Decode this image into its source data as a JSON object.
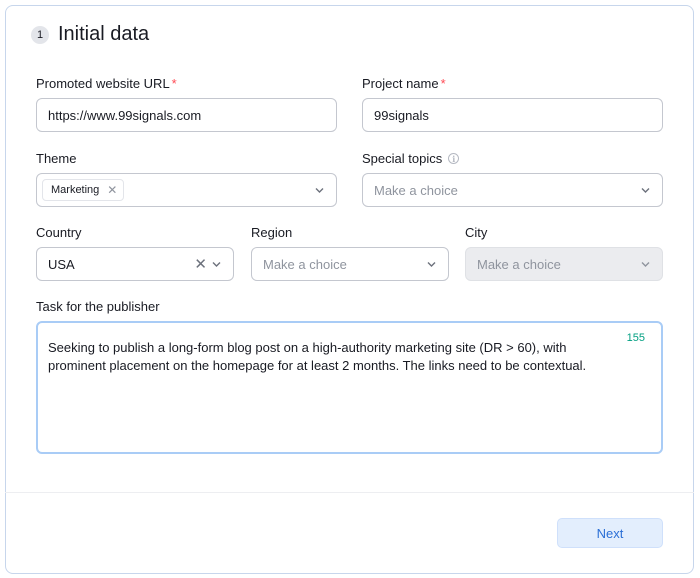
{
  "section": {
    "step": "1",
    "title": "Initial data"
  },
  "fields": {
    "url": {
      "label": "Promoted website URL",
      "required": "*",
      "value": "https://www.99signals.com"
    },
    "project": {
      "label": "Project name",
      "required": "*",
      "value": "99signals"
    },
    "theme": {
      "label": "Theme",
      "tag": "Marketing"
    },
    "topics": {
      "label": "Special topics",
      "placeholder": "Make a choice"
    },
    "country": {
      "label": "Country",
      "value": "USA"
    },
    "region": {
      "label": "Region",
      "placeholder": "Make a choice"
    },
    "city": {
      "label": "City",
      "placeholder": "Make a choice"
    },
    "task": {
      "label": "Task for the publisher",
      "counter": "155",
      "value": "Seeking to publish a long-form blog post on a high-authority marketing site (DR > 60), with prominent placement on the homepage for at least 2 months. The links need to be contextual."
    }
  },
  "actions": {
    "next_label": "Next"
  },
  "icons": {
    "chevron": "chevron-down-icon",
    "close": "close-icon",
    "info": "info-icon"
  }
}
